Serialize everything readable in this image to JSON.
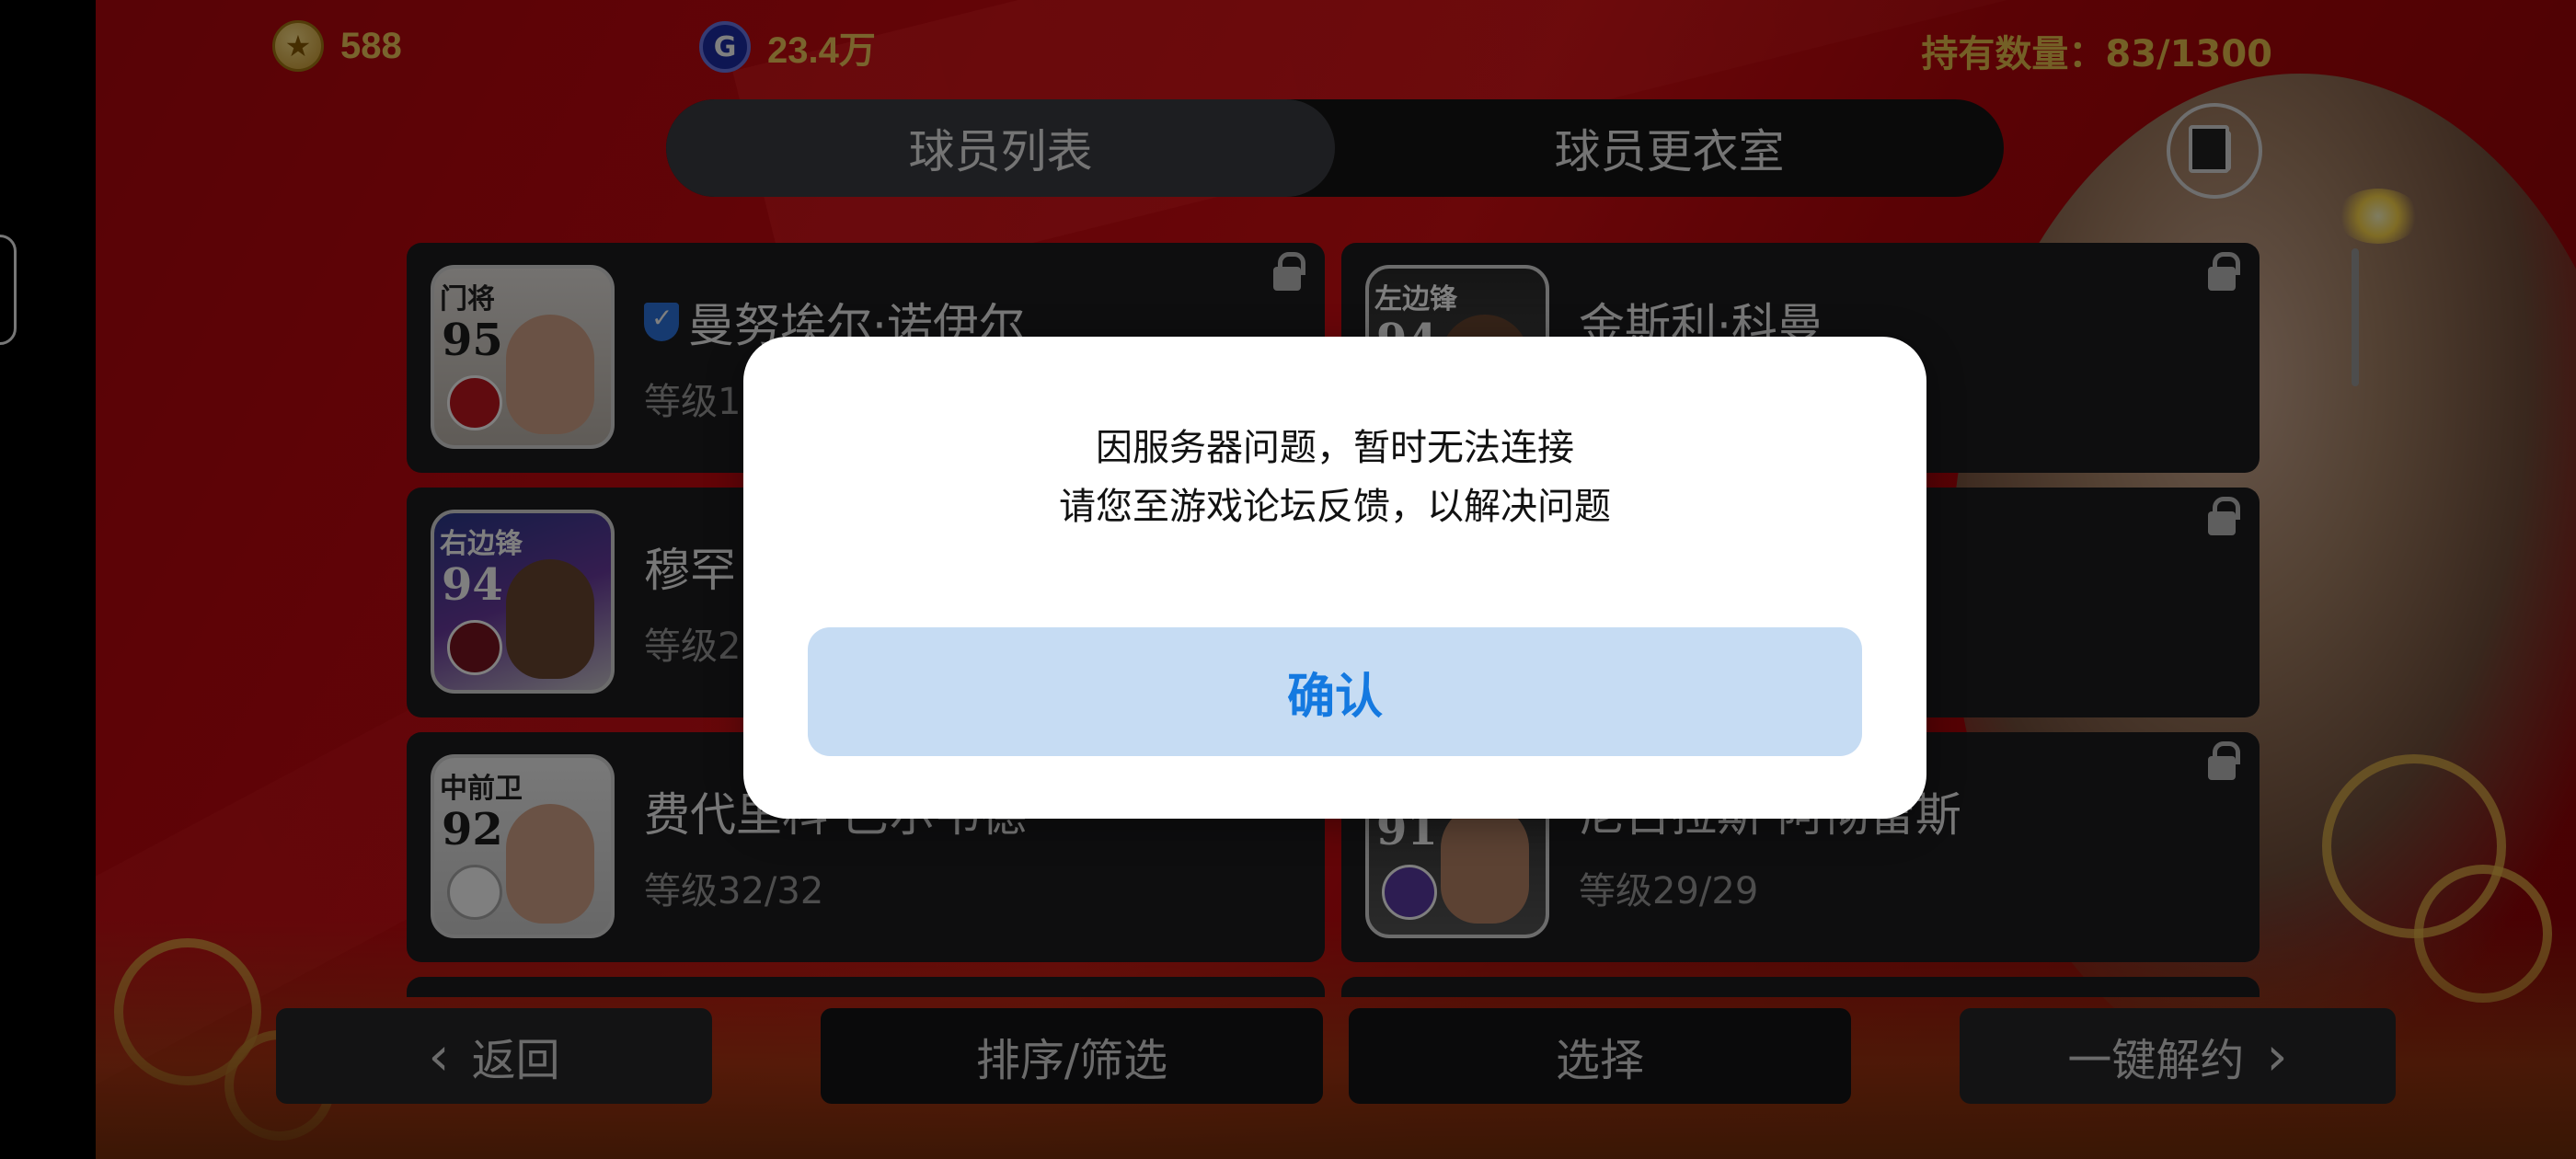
{
  "header": {
    "gold_coins": "588",
    "gp": "23.4万",
    "gp_icon_letter": "G",
    "owned_label": "持有数量：83/1300"
  },
  "tabs": [
    {
      "label": "球员列表",
      "active": true
    },
    {
      "label": "球员更衣室",
      "active": false
    }
  ],
  "players": [
    {
      "position": "门将",
      "rating": "95",
      "name": "曼努埃尔·诺伊尔",
      "level": "等级1",
      "verified": true
    },
    {
      "position": "左边锋",
      "rating": "94",
      "name": "金斯利·科曼",
      "level": ""
    },
    {
      "position": "右边锋",
      "rating": "94",
      "name": "穆罕",
      "level": "等级2"
    },
    {
      "position": "",
      "rating": "",
      "name": "",
      "level": ""
    },
    {
      "position": "中前卫",
      "rating": "92",
      "name": "费代里科·巴尔韦德",
      "level": "等级32/32"
    },
    {
      "position": "",
      "rating": "91",
      "name": "尼古拉斯·阿彻雷斯",
      "level": "等级29/29"
    }
  ],
  "bottom_bar": {
    "back_label": "返回",
    "sort_label": "排序/筛选",
    "select_label": "选择",
    "release_label": "一键解约"
  },
  "dialog": {
    "line1": "因服务器问题，暂时无法连接",
    "line2": "请您至游戏论坛反馈，以解决问题",
    "confirm_label": "确认"
  },
  "colors": {
    "confirm_text": "#1479e0",
    "confirm_bg": "#c6dcf3",
    "currency_text": "#f2c85b",
    "background_red": "#c8080f"
  }
}
